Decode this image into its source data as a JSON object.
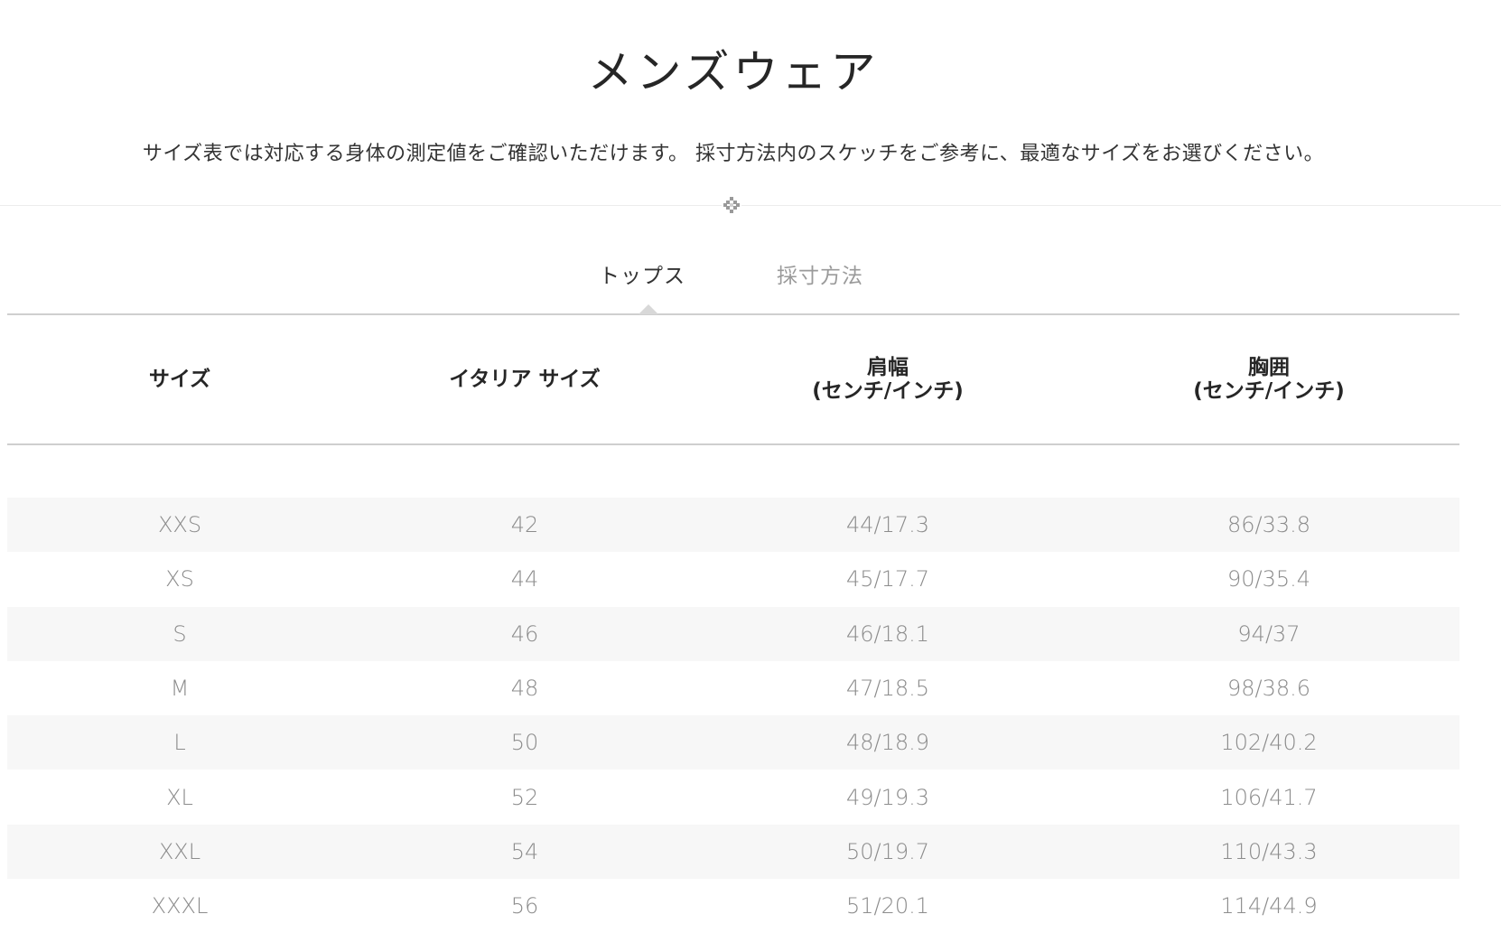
{
  "header": {
    "title": "メンズウェア",
    "subtitle": "サイズ表では対応する身体の測定値をご確認いただけます。 採寸方法内のスケッチをご参考に、最適なサイズをお選びください。"
  },
  "tabs": [
    {
      "label": "トップス",
      "active": true
    },
    {
      "label": "採寸方法",
      "active": false
    }
  ],
  "table": {
    "headers": [
      {
        "line1": "サイズ",
        "line2": ""
      },
      {
        "line1": "イタリア サイズ",
        "line2": ""
      },
      {
        "line1": "肩幅",
        "line2": "(センチ/インチ)"
      },
      {
        "line1": "胸囲",
        "line2": "(センチ/インチ)"
      }
    ],
    "rows": [
      [
        "XXS",
        "42",
        "44/17.3",
        "86/33.8"
      ],
      [
        "XS",
        "44",
        "45/17.7",
        "90/35.4"
      ],
      [
        "S",
        "46",
        "46/18.1",
        "94/37"
      ],
      [
        "M",
        "48",
        "47/18.5",
        "98/38.6"
      ],
      [
        "L",
        "50",
        "48/18.9",
        "102/40.2"
      ],
      [
        "XL",
        "52",
        "49/19.3",
        "106/41.7"
      ],
      [
        "XXL",
        "54",
        "50/19.7",
        "110/43.3"
      ],
      [
        "XXXL",
        "56",
        "51/20.1",
        "114/44.9"
      ]
    ]
  },
  "icons": {
    "ornament": "diamond-ornament-icon",
    "tab_indicator": "caret-up-icon"
  },
  "colors": {
    "text": "#262626",
    "muted": "#8c8c8c",
    "row_shade": "#f7f7f7",
    "rule": "#cfcfcf"
  }
}
